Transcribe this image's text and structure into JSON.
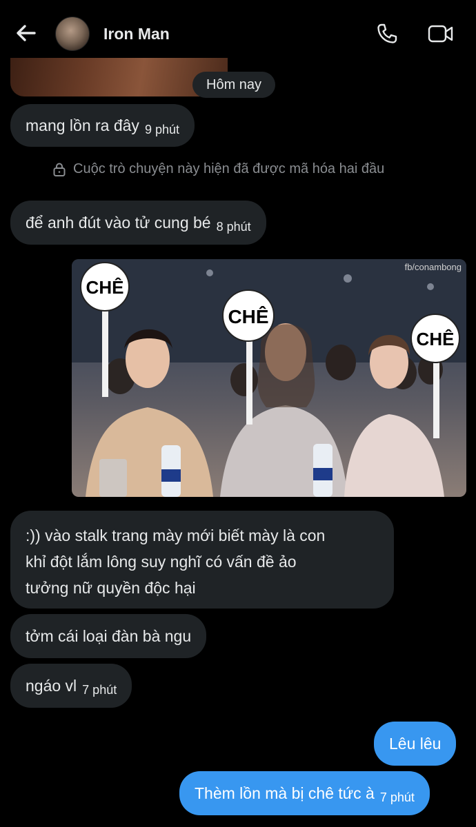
{
  "header": {
    "contact_name": "Iron Man",
    "back_icon": "arrow-left-icon",
    "call_icon": "phone-icon",
    "video_icon": "video-camera-icon"
  },
  "date_separator": "Hôm nay",
  "encryption_notice": "Cuộc trò chuyện này hiện đã được mã hóa hai đầu",
  "messages": [
    {
      "side": "received",
      "text": "mang lồn ra đây",
      "time": "9 phút"
    },
    {
      "side": "received",
      "text": "để anh đút vào tử cung bé",
      "time": "8 phút"
    },
    {
      "side": "received",
      "type": "image",
      "watermark": "fb/conambong",
      "sign_labels": [
        "CHÊ",
        "CHÊ",
        "CHÊ"
      ]
    },
    {
      "side": "received",
      "text_lines": [
        ":)) vào stalk trang mày mới biết mày là con",
        "khỉ đột lắm lông suy nghĩ có vấn đề ảo",
        "tưởng nữ quyền độc hại"
      ]
    },
    {
      "side": "received",
      "text": "tởm cái loại đàn bà ngu"
    },
    {
      "side": "received",
      "text": "ngáo vl",
      "time": "7 phút"
    },
    {
      "side": "sent",
      "text": "Lêu lêu"
    },
    {
      "side": "sent",
      "text": "Thèm lồn mà bị chê tức à",
      "time": "7 phút"
    }
  ],
  "colors": {
    "background": "#000000",
    "received_bubble": "#1f2326",
    "sent_bubble": "#3897f0",
    "muted_text": "#8a8d91"
  }
}
